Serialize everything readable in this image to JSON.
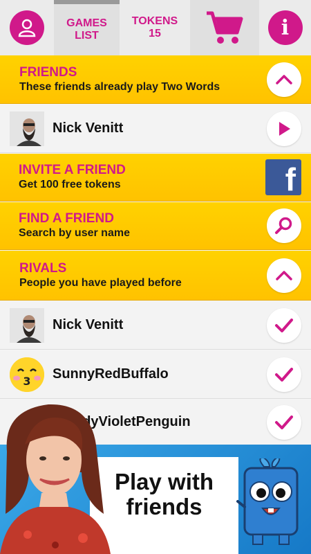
{
  "topbar": {
    "games_label": "GAMES\nLIST",
    "games_line1": "GAMES",
    "games_line2": "LIST",
    "tokens_line1": "TOKENS",
    "tokens_line2": "15"
  },
  "friends_header": {
    "title": "FRIENDS",
    "subtitle": "These friends already play Two Words"
  },
  "friend_row": {
    "name": "Nick Venitt"
  },
  "invite": {
    "title": "INVITE A FRIEND",
    "subtitle": "Get 100 free tokens"
  },
  "find": {
    "title": "FIND A FRIEND",
    "subtitle": "Search by user name"
  },
  "rivals_header": {
    "title": "RIVALS",
    "subtitle": "People you have played before"
  },
  "rivals": [
    {
      "name": "Nick Venitt"
    },
    {
      "name": "SunnyRedBuffalo"
    },
    {
      "name": "odyVioletPenguin"
    }
  ],
  "banner": {
    "line1": "Play with",
    "line2": "friends"
  },
  "colors": {
    "accent": "#d0198a",
    "yellow": "#ffc800",
    "facebook": "#3b5998"
  }
}
